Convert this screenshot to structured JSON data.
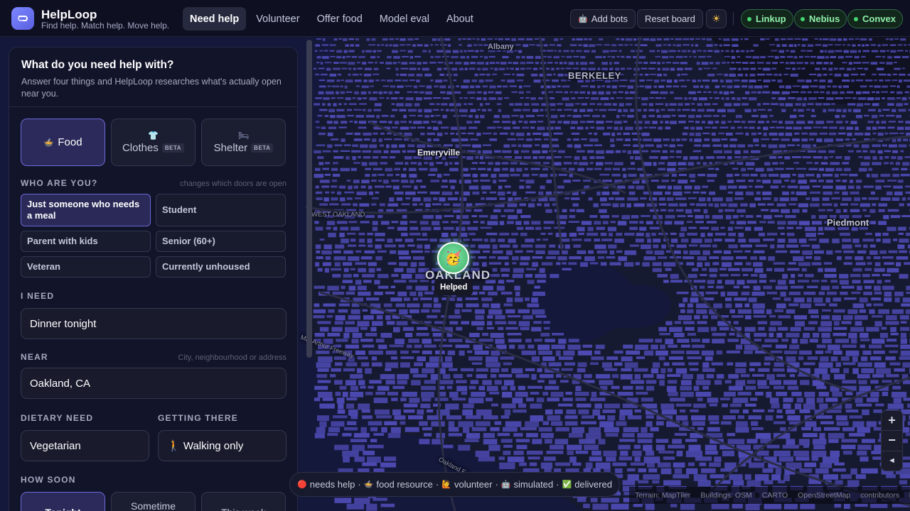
{
  "header": {
    "brand": "HelpLoop",
    "tagline": "Find help. Match help. Move help.",
    "nav": [
      "Need help",
      "Volunteer",
      "Offer food",
      "Model eval",
      "About"
    ],
    "active_nav": "Need help",
    "add_bots_label": "Add bots",
    "reset_board_label": "Reset board",
    "theme_icon": "sun-icon",
    "status": [
      "Linkup",
      "Nebius",
      "Convex"
    ],
    "status_color": "#45d672"
  },
  "panel": {
    "title": "What do you need help with?",
    "subtitle": "Answer four things and HelpLoop researches what's actually open near you.",
    "categories": [
      {
        "icon": "🍲",
        "label": "Food",
        "beta": "",
        "active": true
      },
      {
        "icon": "👕",
        "label": "Clothes",
        "beta": "BETA",
        "active": false
      },
      {
        "icon": "🛏",
        "label": "Shelter",
        "beta": "BETA",
        "active": false
      }
    ],
    "who": {
      "label": "WHO ARE YOU?",
      "hint": "changes which doors are open",
      "options": [
        "Just someone who needs a meal",
        "Student",
        "Parent with kids",
        "Senior (60+)",
        "Veteran",
        "Currently unhoused"
      ],
      "selected": "Just someone who needs a meal"
    },
    "need": {
      "label": "I NEED",
      "value": "Dinner tonight"
    },
    "near": {
      "label": "NEAR",
      "hint": "City, neighbourhood or address",
      "value": "Oakland, CA"
    },
    "dietary": {
      "label": "DIETARY NEED",
      "value": "Vegetarian"
    },
    "getting_there": {
      "label": "GETTING THERE",
      "value": "🚶 Walking only"
    },
    "how_soon": {
      "label": "HOW SOON",
      "options": [
        "Tonight",
        "Sometime today",
        "This week"
      ],
      "selected": "Tonight"
    }
  },
  "map": {
    "labels": [
      "Albany",
      "BERKELEY",
      "Emeryville",
      "WEST OAKLAND",
      "Piedmont",
      "OAKLAND",
      "Oakland Estuary",
      "MacArthur Freeway"
    ],
    "pin_label": "Helped",
    "pin_icon": "🥳",
    "building_color": "#4d4ab3",
    "water_color": "#14183a"
  },
  "legend": [
    {
      "icon": "🔴",
      "label": "needs help"
    },
    {
      "icon": "🍲",
      "label": "food resource"
    },
    {
      "icon": "🙋",
      "label": "volunteer"
    },
    {
      "icon": "🤖",
      "label": "simulated"
    },
    {
      "icon": "✅",
      "label": "delivered"
    }
  ],
  "zoom": {
    "in": "+",
    "out": "−",
    "compass": "◄"
  },
  "attribution": [
    "Terrain: MapTiler",
    "Buildings: OSM",
    "CARTO",
    "OpenStreetMap",
    "contributors"
  ]
}
